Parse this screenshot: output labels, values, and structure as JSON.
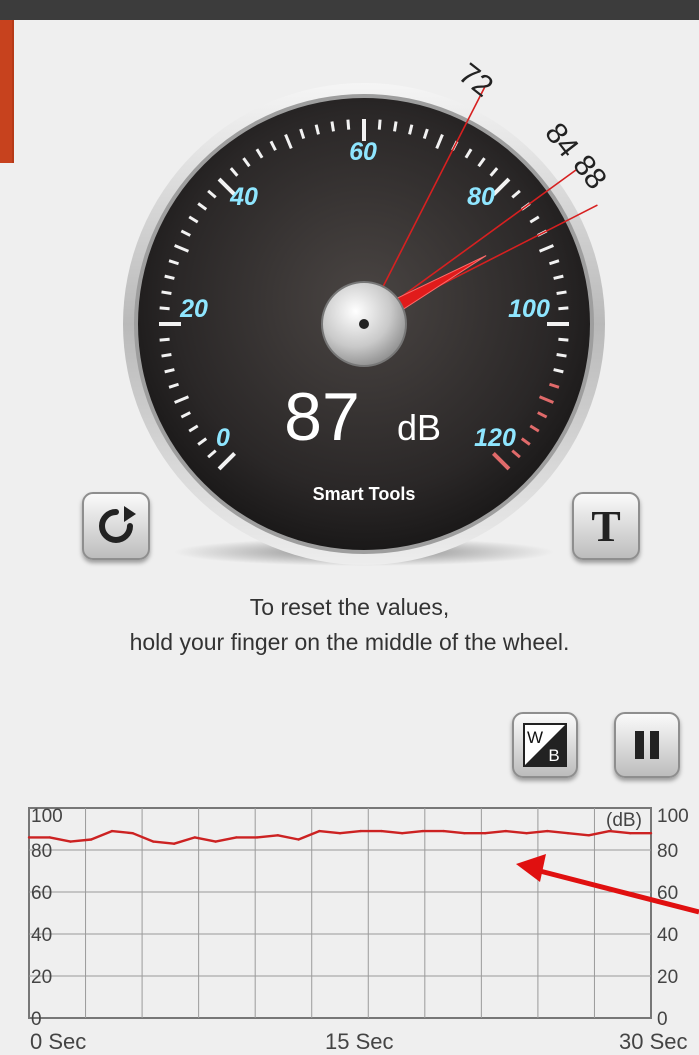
{
  "meter": {
    "reading": "87",
    "unit": "dB",
    "brand": "Smart Tools",
    "scale_labels": [
      "0",
      "20",
      "40",
      "60",
      "80",
      "100",
      "120"
    ],
    "marker_labels": [
      "72",
      "84",
      "88"
    ],
    "needle_value_db": 87,
    "min_marker_db": 72,
    "avg_marker_db": 84,
    "max_marker_db": 88,
    "scale_max_db": 120
  },
  "hint": {
    "line1": "To reset the values,",
    "line2": "hold your finger on the middle of the wheel."
  },
  "buttons": {
    "reset_icon": "refresh-icon",
    "theme_label": "T",
    "wb_top": "W",
    "wb_bottom": "B",
    "pause_icon": "pause-icon"
  },
  "graph": {
    "unit_label": "(dB)",
    "y_labels_left": [
      "100",
      "80",
      "60",
      "40",
      "20",
      "0"
    ],
    "y_labels_right": [
      "100",
      "80",
      "60",
      "40",
      "20",
      "0"
    ],
    "x_labels": [
      "0 Sec",
      "15 Sec",
      "30 Sec"
    ],
    "line_color": "#cc2222"
  },
  "annotation": {
    "arrow_color": "#e01010"
  },
  "chart_data": {
    "type": "line",
    "x": [
      0,
      1,
      2,
      3,
      4,
      5,
      6,
      7,
      8,
      9,
      10,
      11,
      12,
      13,
      14,
      15,
      16,
      17,
      18,
      19,
      20,
      21,
      22,
      23,
      24,
      25,
      26,
      27,
      28,
      29,
      30
    ],
    "series": [
      {
        "values": [
          86,
          86,
          84,
          85,
          89,
          88,
          84,
          83,
          86,
          84,
          86,
          86,
          87,
          85,
          89,
          88,
          89,
          89,
          88,
          89,
          89,
          88,
          88,
          89,
          88,
          89,
          88,
          87,
          89,
          88,
          88
        ]
      }
    ],
    "xlabel": "",
    "ylabel": "(dB)",
    "xlim": [
      0,
      30
    ],
    "ylim": [
      0,
      100
    ],
    "x_tick_labels": [
      "0 Sec",
      "15 Sec",
      "30 Sec"
    ],
    "y_ticks": [
      0,
      20,
      40,
      60,
      80,
      100
    ],
    "grid": true
  }
}
